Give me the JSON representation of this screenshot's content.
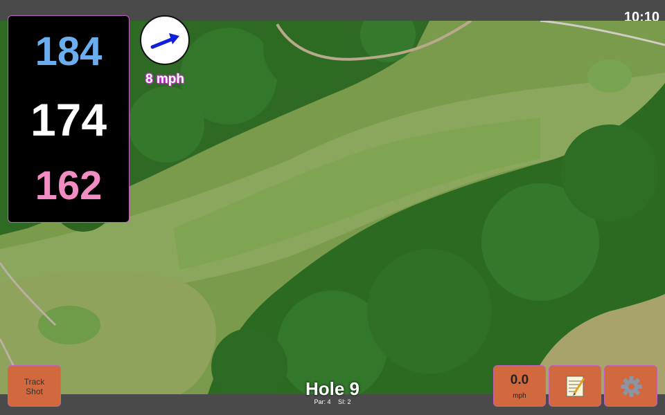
{
  "status_bar": {
    "time": "10:10"
  },
  "distances": {
    "back": "184",
    "middle": "174",
    "front": "162"
  },
  "wind": {
    "speed_label": "8 mph",
    "direction_icon": "wind-arrow-icon"
  },
  "hole": {
    "title": "Hole 9",
    "par": "Par: 4",
    "si": "SI: 2"
  },
  "buttons": {
    "track_shot": {
      "line1": "Track",
      "line2": "Shot"
    },
    "speed": {
      "value": "0.0",
      "unit": "mph"
    },
    "notes_icon": "notepad-icon",
    "settings_icon": "gear-icon"
  },
  "colors": {
    "back_distance": "#6aaef0",
    "middle_distance": "#ffffff",
    "front_distance": "#f48cc4",
    "button_bg": "#d2683e"
  }
}
